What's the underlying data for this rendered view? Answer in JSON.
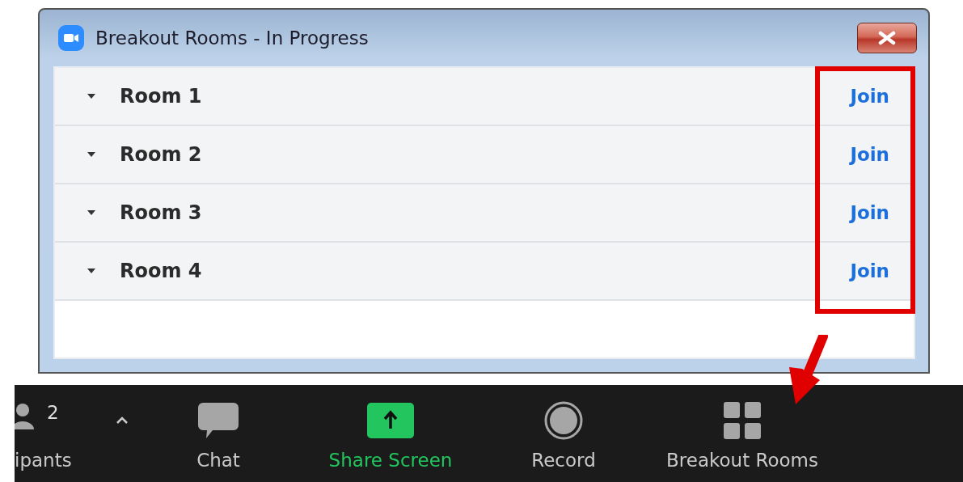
{
  "window": {
    "title": "Breakout Rooms - In Progress",
    "rooms": [
      {
        "name": "Room 1",
        "action": "Join"
      },
      {
        "name": "Room 2",
        "action": "Join"
      },
      {
        "name": "Room 3",
        "action": "Join"
      },
      {
        "name": "Room 4",
        "action": "Join"
      }
    ]
  },
  "toolbar": [
    {
      "kind": "participants",
      "label": "ipants",
      "count": "2"
    },
    {
      "kind": "chat",
      "label": "Chat"
    },
    {
      "kind": "share",
      "label": "Share Screen"
    },
    {
      "kind": "record",
      "label": "Record"
    },
    {
      "kind": "breakout",
      "label": "Breakout Rooms"
    }
  ],
  "annotations": {
    "highlight_box": true,
    "arrow": true
  }
}
